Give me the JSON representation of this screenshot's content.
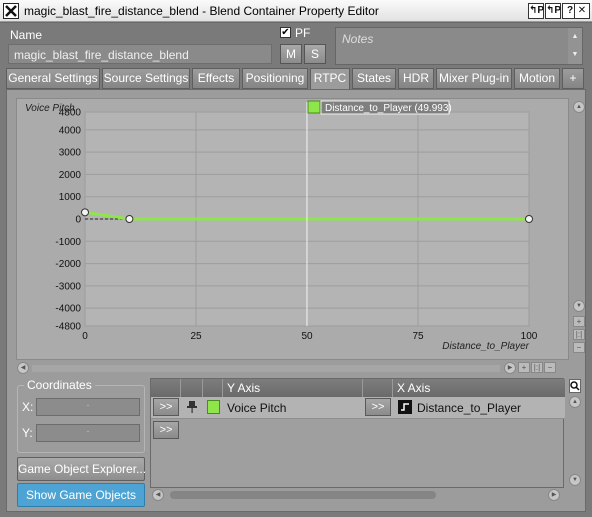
{
  "window": {
    "title": "magic_blast_fire_distance_blend - Blend Container Property Editor",
    "buttons": [
      "↰P",
      "↰P",
      "?",
      "✕"
    ]
  },
  "name_label": "Name",
  "name_value": "magic_blast_fire_distance_blend",
  "pf": {
    "label": "PF",
    "checked": true,
    "mark": "✔"
  },
  "m_label": "M",
  "s_label": "S",
  "notes_placeholder": "Notes",
  "tabs": [
    "General Settings",
    "Source Settings",
    "Effects",
    "Positioning",
    "RTPC",
    "States",
    "HDR",
    "Mixer Plug-in",
    "Motion",
    "+"
  ],
  "active_tab": "RTPC",
  "graph": {
    "ylabel": "Voice Pitch",
    "xlabel": "Distance_to_Player",
    "y_ticks": [
      "4800",
      "4000",
      "3000",
      "2000",
      "1000",
      "0",
      "-1000",
      "-2000",
      "-3000",
      "-4000",
      "-4800"
    ],
    "x_ticks": [
      "0",
      "25",
      "50",
      "75",
      "100"
    ],
    "cursor_label": "Distance_to_Player (49.993)",
    "cursor_value": 49.993,
    "accent": "#8ee64a"
  },
  "chart_data": {
    "type": "line",
    "xlabel": "Distance_to_Player",
    "ylabel": "Voice Pitch",
    "xlim": [
      0,
      100
    ],
    "ylim": [
      -4800,
      4800
    ],
    "series": [
      {
        "name": "Voice Pitch",
        "x": [
          0,
          10,
          100
        ],
        "y": [
          300,
          0,
          0
        ]
      }
    ]
  },
  "coordinates": {
    "title": "Coordinates",
    "x_label": "X:",
    "y_label": "Y:",
    "x_value": "-",
    "y_value": "-"
  },
  "buttons": {
    "explorer": "Game Object Explorer...",
    "show_objects": "Show Game Objects"
  },
  "table": {
    "headers": {
      "y_axis": "Y Axis",
      "x_axis": "X Axis"
    },
    "rows": [
      {
        "expand": ">>",
        "y_axis": "Voice Pitch",
        "x_expand": ">>",
        "x_axis": "Distance_to_Player"
      }
    ],
    "new_row": ">>"
  }
}
